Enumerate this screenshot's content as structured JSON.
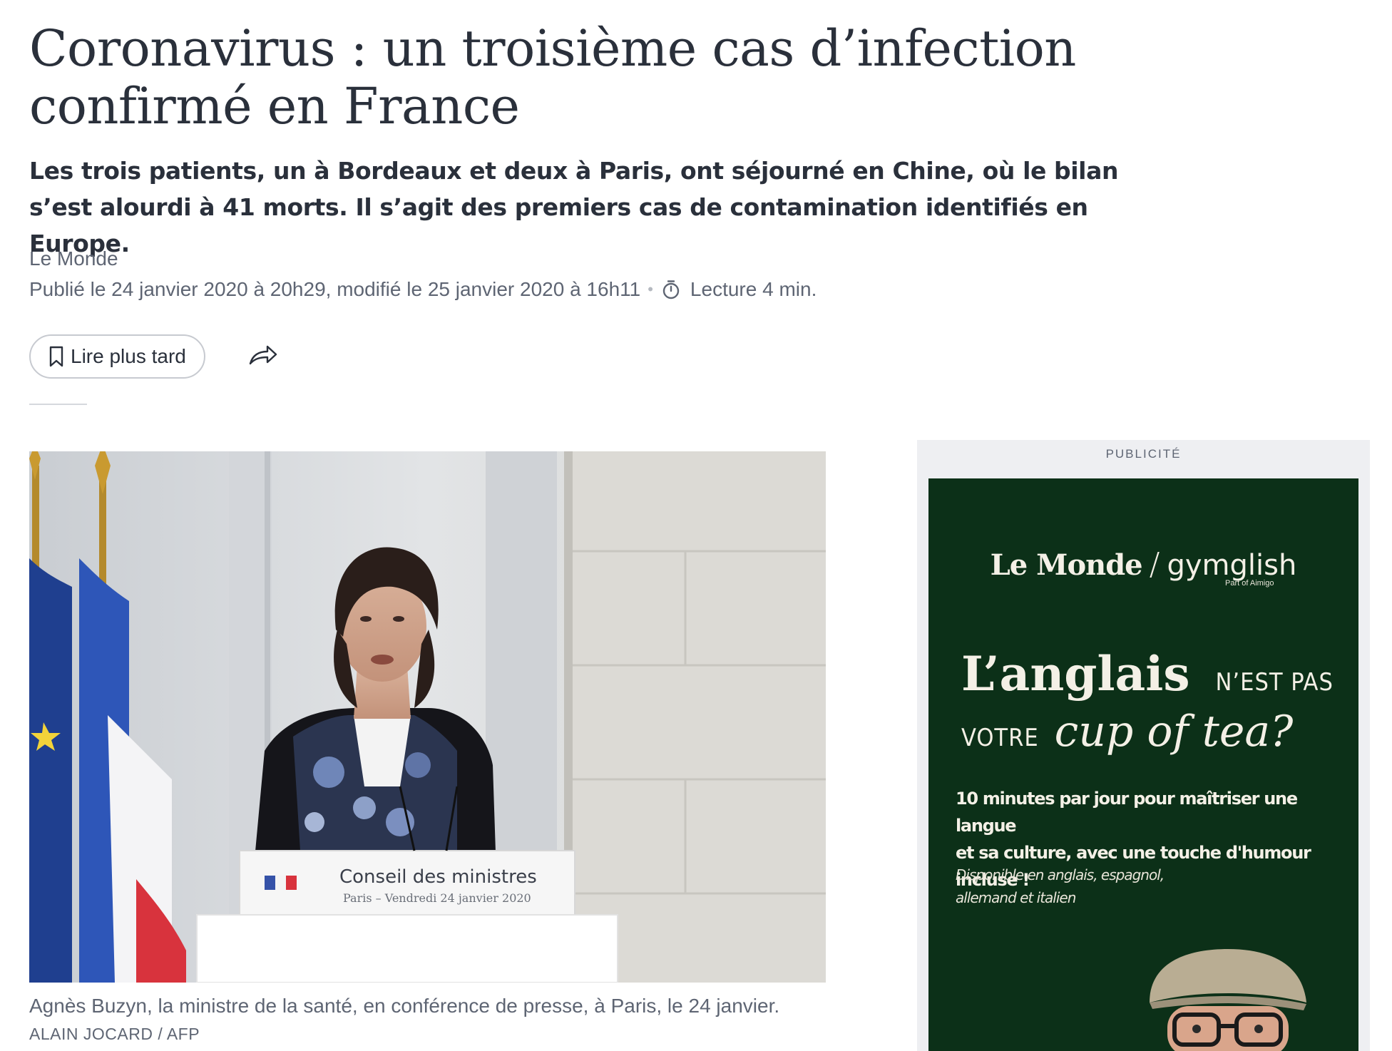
{
  "article": {
    "title": "Coronavirus : un troisième cas d’infection confirmé en France",
    "standfirst": "Les trois patients, un à Bordeaux et deux à Paris, ont séjourné en Chine, où le bilan s’est alourdi à 41 morts. Il s’agit des premiers cas de contamination identifiés en Europe.",
    "author": "Le Monde",
    "published": "Publié le 24 janvier 2020 à 20h29, modifié le 25 janvier 2020 à 16h11",
    "separator": "•",
    "reading_time": "Lecture 4 min."
  },
  "actions": {
    "save_label": "Lire plus tard",
    "save_icon": "bookmark-icon",
    "share_icon": "share-icon",
    "timer_icon": "timer-icon"
  },
  "photo": {
    "podium_title": "Conseil des ministres",
    "podium_subtitle": "Paris – Vendredi 24 janvier 2020",
    "caption": "Agnès Buzyn, la ministre de la santé, en conférence de presse, à Paris, le 24 janvier.",
    "credit": "ALAIN JOCARD / AFP"
  },
  "ad": {
    "label": "PUBLICITÉ",
    "brand_left": "Le Monde",
    "brand_sep": "/",
    "brand_right": "gymglish",
    "brand_sub": "Part of Aimigo",
    "line1_big": "L’anglais",
    "line1_small": "N’EST PAS",
    "line2_small": "VOTRE",
    "line2_script": "cup of tea?",
    "body_line1": "10 minutes par jour pour maîtriser une langue",
    "body_line2": "et sa culture, avec une touche d'humour incluse !",
    "avail_line1": "Disponible en anglais, espagnol,",
    "avail_line2": "allemand et italien",
    "colors": {
      "background": "#0c3018",
      "text": "#f4f0e6"
    }
  },
  "theme": {
    "text": "#2a303b",
    "muted": "#5e6573",
    "border": "#c7cad0"
  }
}
